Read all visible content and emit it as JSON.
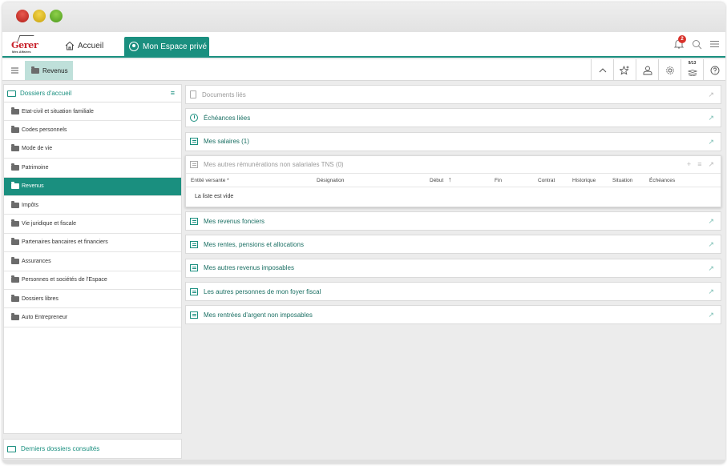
{
  "header": {
    "logo_text": "Gerer",
    "logo_sub": "Mes Affaires",
    "home_label": "Accueil",
    "espace_label": "Mon Espace privé",
    "notif_count": "2"
  },
  "toolbar": {
    "crumb_label": "Revenus",
    "calendar_badge": "9/13"
  },
  "sidebar": {
    "title": "Dossiers d'accueil",
    "items": [
      {
        "label": "Etat-civil et situation familiale"
      },
      {
        "label": "Codes personnels"
      },
      {
        "label": "Mode de vie"
      },
      {
        "label": "Patrimoine"
      },
      {
        "label": "Revenus"
      },
      {
        "label": "Impôts"
      },
      {
        "label": "Vie juridique et fiscale"
      },
      {
        "label": "Partenaires bancaires et financiers"
      },
      {
        "label": "Assurances"
      },
      {
        "label": "Personnes et sociétés de l'Espace"
      },
      {
        "label": "Dossiers libres"
      },
      {
        "label": "Auto Entrepreneur"
      }
    ],
    "footer": "Derniers dossiers consultés"
  },
  "main": {
    "documents": "Documents liés",
    "echeances": "Échéances liées",
    "salaires": "Mes salaires (1)",
    "tns": {
      "title": "Mes autres rémunérations non salariales TNS (0)",
      "columns": [
        "Entité versante *",
        "Désignation",
        "Début",
        "Fin",
        "Contrat",
        "Historique",
        "Situation",
        "Échéances"
      ],
      "empty": "La liste est vide"
    },
    "fonciers": "Mes revenus fonciers",
    "rentes": "Mes rentes, pensions et allocations",
    "imposables": "Mes autres revenus imposables",
    "foyer": "Les autres personnes de mon foyer fiscal",
    "rentrees": "Mes rentrées d'argent non imposables"
  }
}
